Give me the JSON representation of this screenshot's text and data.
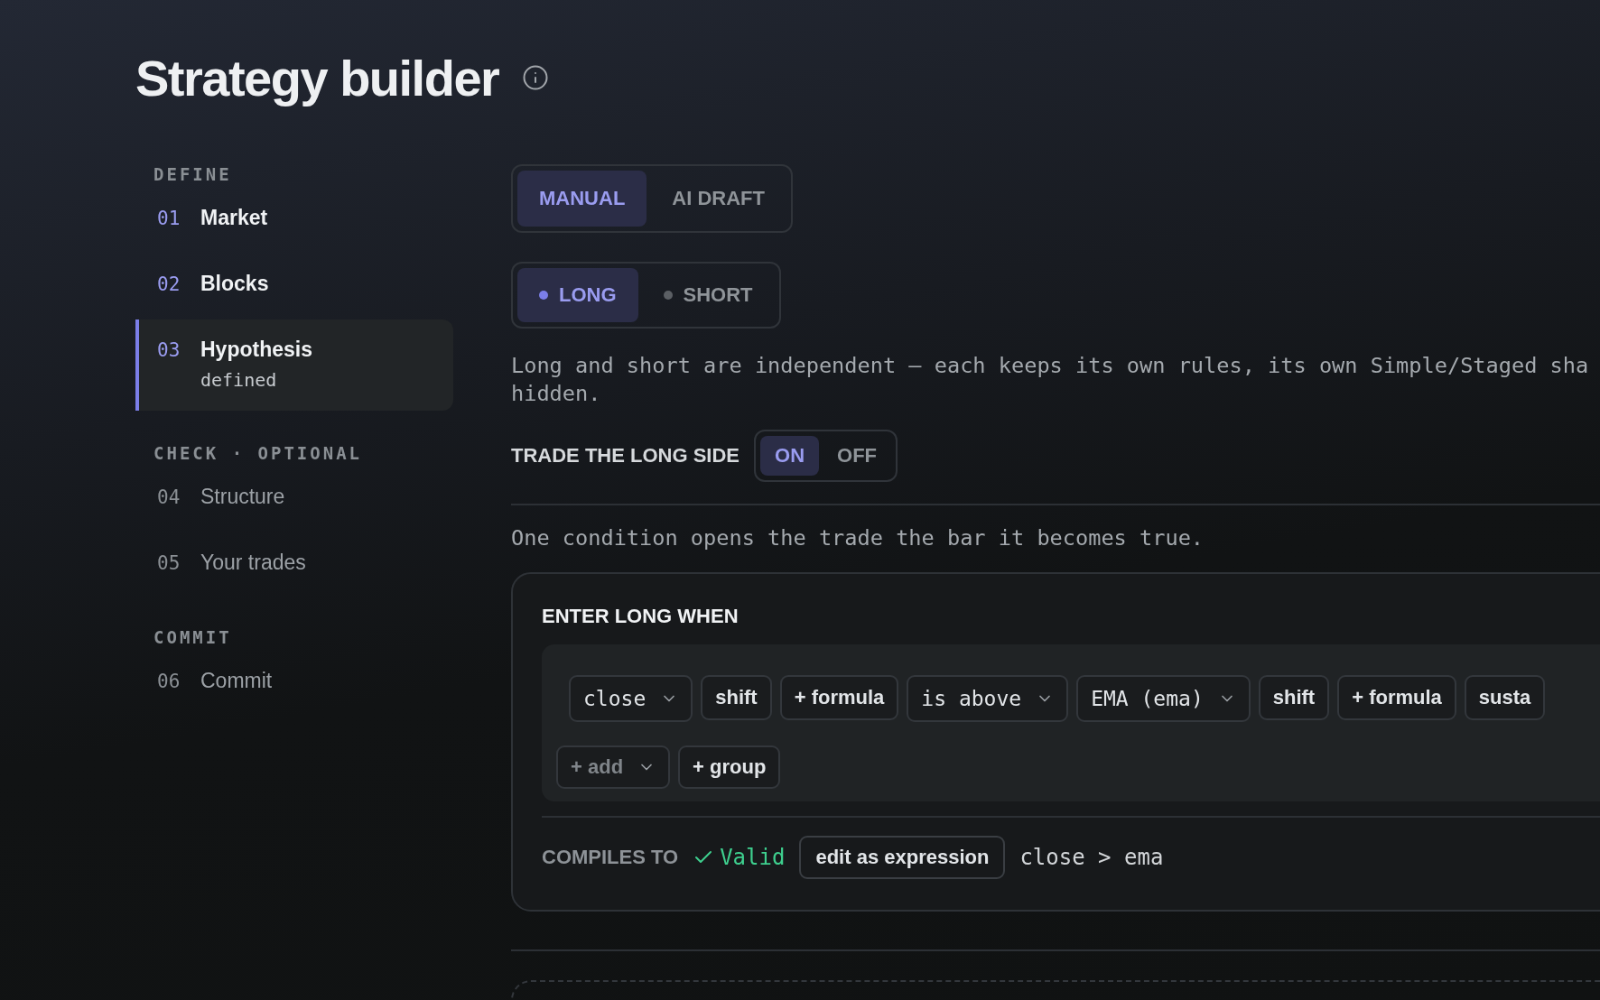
{
  "header": {
    "title": "Strategy builder"
  },
  "sidebar": {
    "sections": [
      {
        "heading": "DEFINE",
        "items": [
          {
            "number": "01",
            "label": "Market",
            "done": true,
            "selected": false
          },
          {
            "number": "02",
            "label": "Blocks",
            "done": true,
            "selected": false
          },
          {
            "number": "03",
            "label": "Hypothesis",
            "status": "defined",
            "done": true,
            "selected": true
          }
        ]
      },
      {
        "heading": "CHECK · OPTIONAL",
        "items": [
          {
            "number": "04",
            "label": "Structure",
            "done": false,
            "selected": false
          },
          {
            "number": "05",
            "label": "Your trades",
            "done": false,
            "selected": false
          }
        ]
      },
      {
        "heading": "COMMIT",
        "items": [
          {
            "number": "06",
            "label": "Commit",
            "done": false,
            "selected": false
          }
        ]
      }
    ]
  },
  "mode_tabs": [
    {
      "label": "MANUAL",
      "selected": true
    },
    {
      "label": "AI DRAFT",
      "selected": false
    }
  ],
  "side_tabs": [
    {
      "label": "LONG",
      "selected": true
    },
    {
      "label": "SHORT",
      "selected": false
    }
  ],
  "description": [
    "Long and short are independent — each keeps its own rules, its own Simple/Staged sha",
    "hidden."
  ],
  "trade_toggle": {
    "label": "TRADE THE LONG SIDE",
    "options": [
      {
        "label": "ON",
        "selected": true
      },
      {
        "label": "OFF",
        "selected": false
      }
    ]
  },
  "hint": "One condition opens the trade the bar it becomes true.",
  "entry_card": {
    "title": "ENTER LONG WHEN",
    "tokens": [
      {
        "kind": "select",
        "label": "close"
      },
      {
        "kind": "button",
        "label": "shift"
      },
      {
        "kind": "button",
        "label": "+ formula"
      },
      {
        "kind": "select",
        "label": "is above"
      },
      {
        "kind": "select",
        "label": "EMA (ema)"
      },
      {
        "kind": "button",
        "label": "shift"
      },
      {
        "kind": "button",
        "label": "+ formula"
      },
      {
        "kind": "button",
        "label": "susta"
      }
    ],
    "actions": [
      {
        "kind": "select",
        "label": "+ add",
        "disabled": true
      },
      {
        "kind": "button",
        "label": "+ group",
        "disabled": false
      }
    ],
    "compile": {
      "label": "COMPILES TO",
      "valid": true,
      "status": "Valid",
      "button": "edit as expression",
      "expression": "close > ema"
    }
  }
}
